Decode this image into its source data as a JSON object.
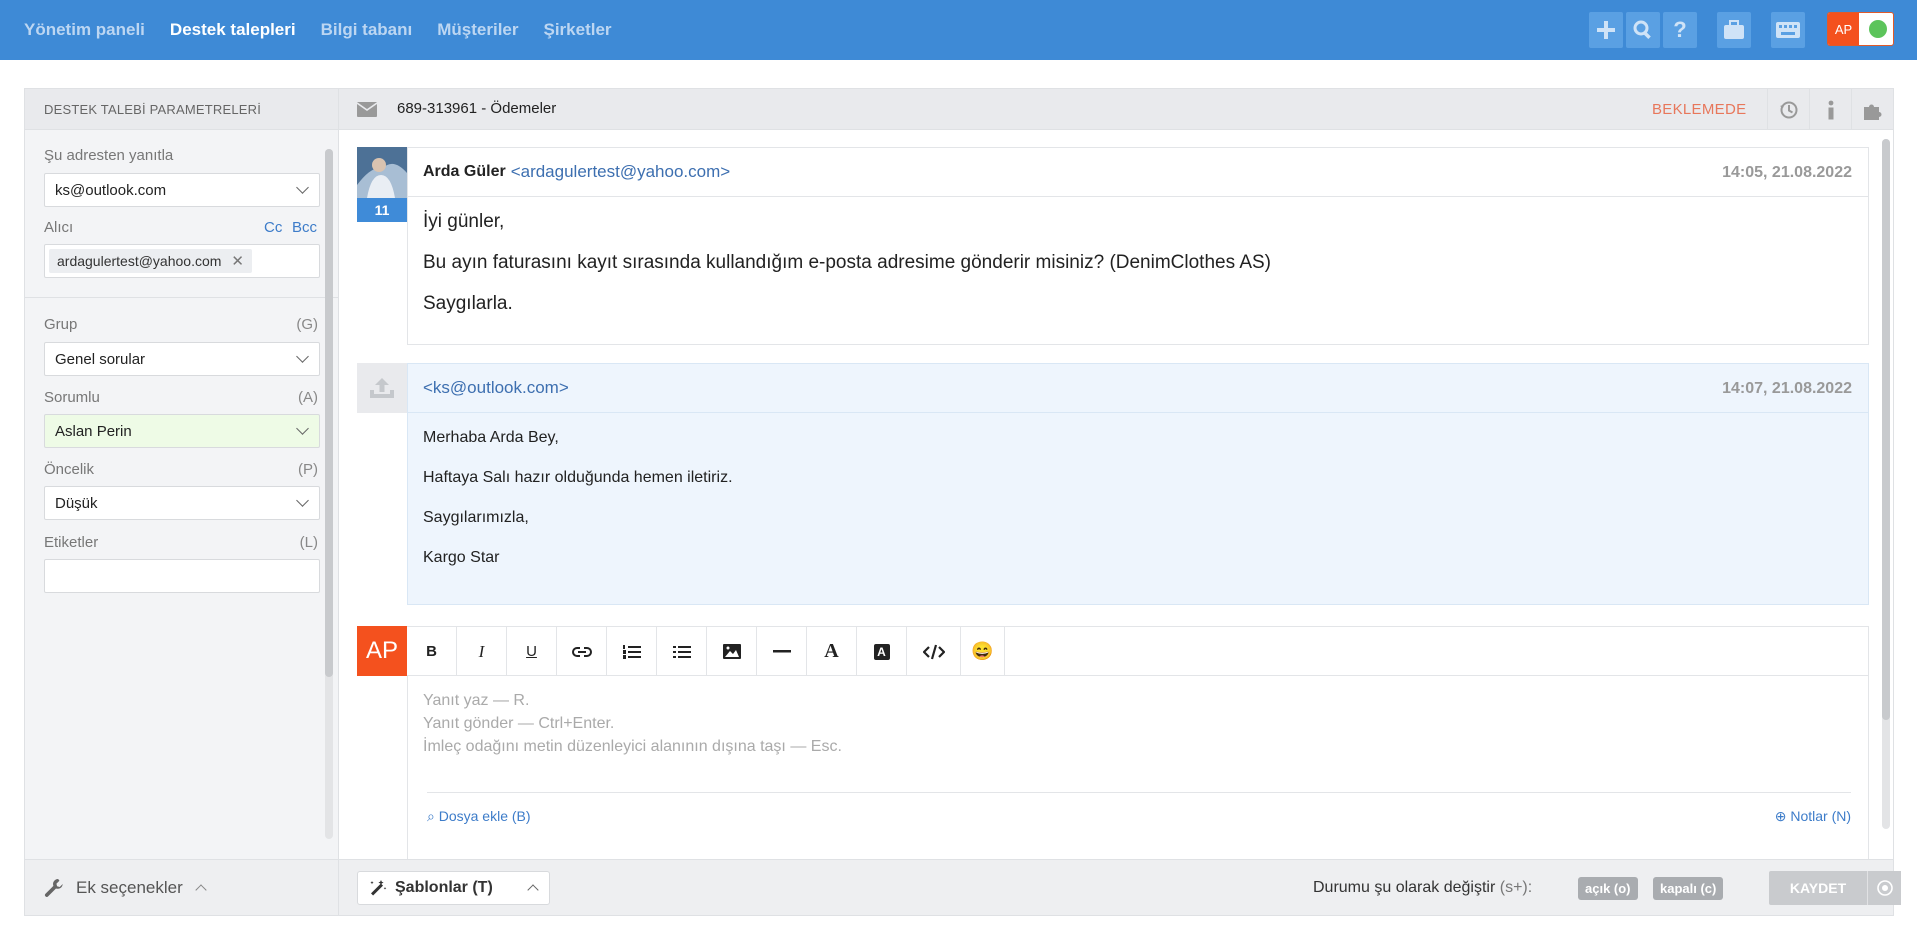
{
  "nav": {
    "items": [
      {
        "label": "Yönetim paneli",
        "active": false
      },
      {
        "label": "Destek talepleri",
        "active": true
      },
      {
        "label": "Bilgi tabanı",
        "active": false
      },
      {
        "label": "Müşteriler",
        "active": false
      },
      {
        "label": "Şirketler",
        "active": false
      }
    ],
    "icons": [
      "plus-icon",
      "search-icon",
      "help-icon",
      "briefcase-icon",
      "keyboard-icon"
    ],
    "avatar_initials": "AP",
    "online_color": "#5cc45b"
  },
  "sidebar": {
    "title": "DESTEK TALEBİ PARAMETRELERİ",
    "reply_from_label": "Şu adresten yanıtla",
    "reply_from_value": "ks@outlook.com",
    "recipient_label": "Alıcı",
    "cc_label": "Cc",
    "bcc_label": "Bcc",
    "recipient_chip": "ardagulertest@yahoo.com",
    "group_label": "Grup",
    "group_hint": "(G)",
    "group_value": "Genel sorular",
    "assignee_label": "Sorumlu",
    "assignee_hint": "(A)",
    "assignee_value": "Aslan Perin",
    "priority_label": "Öncelik",
    "priority_hint": "(P)",
    "priority_value": "Düşük",
    "tags_label": "Etiketler",
    "tags_hint": "(L)",
    "tags_value": "",
    "extra_options": "Ek seçenekler"
  },
  "ticket": {
    "subject": "689-313961 - Ödemeler",
    "status": "BEKLEMEDE",
    "status_color": "#e8775b"
  },
  "messages": [
    {
      "sender": "Arda Güler",
      "email": "<ardagulertest@yahoo.com>",
      "date": "14:05, 21.08.2022",
      "avatar_count": "11",
      "lines": [
        "İyi günler,",
        "Bu ayın faturasını kayıt sırasında kullandığım e-posta adresime gönderir misiniz? (DenimClothes AS)",
        "Saygılarla."
      ]
    },
    {
      "sender": "",
      "email": "<ks@outlook.com>",
      "date": "14:07, 21.08.2022",
      "lines": [
        "Merhaba Arda Bey,",
        "Haftaya Salı hazır olduğunda hemen iletiriz.",
        "Saygılarımızla,",
        "Kargo Star"
      ]
    }
  ],
  "editor": {
    "avatar_initials": "AP",
    "toolbar": [
      {
        "name": "bold-button",
        "glyph": "B"
      },
      {
        "name": "italic-button",
        "glyph": "I"
      },
      {
        "name": "underline-button",
        "glyph": "U"
      },
      {
        "name": "link-icon",
        "glyph": ""
      },
      {
        "name": "ordered-list-icon",
        "glyph": ""
      },
      {
        "name": "bullet-list-icon",
        "glyph": ""
      },
      {
        "name": "image-icon",
        "glyph": ""
      },
      {
        "name": "horizontal-rule-icon",
        "glyph": ""
      },
      {
        "name": "font-color-icon",
        "glyph": "A"
      },
      {
        "name": "background-color-icon",
        "glyph": "A"
      },
      {
        "name": "code-icon",
        "glyph": ""
      },
      {
        "name": "emoji-icon",
        "glyph": "😄"
      }
    ],
    "placeholder_lines": [
      "Yanıt yaz — R.",
      "Yanıt gönder — Ctrl+Enter.",
      "İmleç odağını metin düzenleyici alanının dışına taşı — Esc."
    ],
    "attach_label": "Dosya ekle (B)",
    "notes_label": "Notlar (N)"
  },
  "footer": {
    "templates_label": "Şablonlar (T)",
    "change_status_label": "Durumu şu olarak değiştir",
    "change_status_hint": "(s+):",
    "open_label": "açık (o)",
    "closed_label": "kapalı (c)",
    "save_label": "KAYDET"
  }
}
